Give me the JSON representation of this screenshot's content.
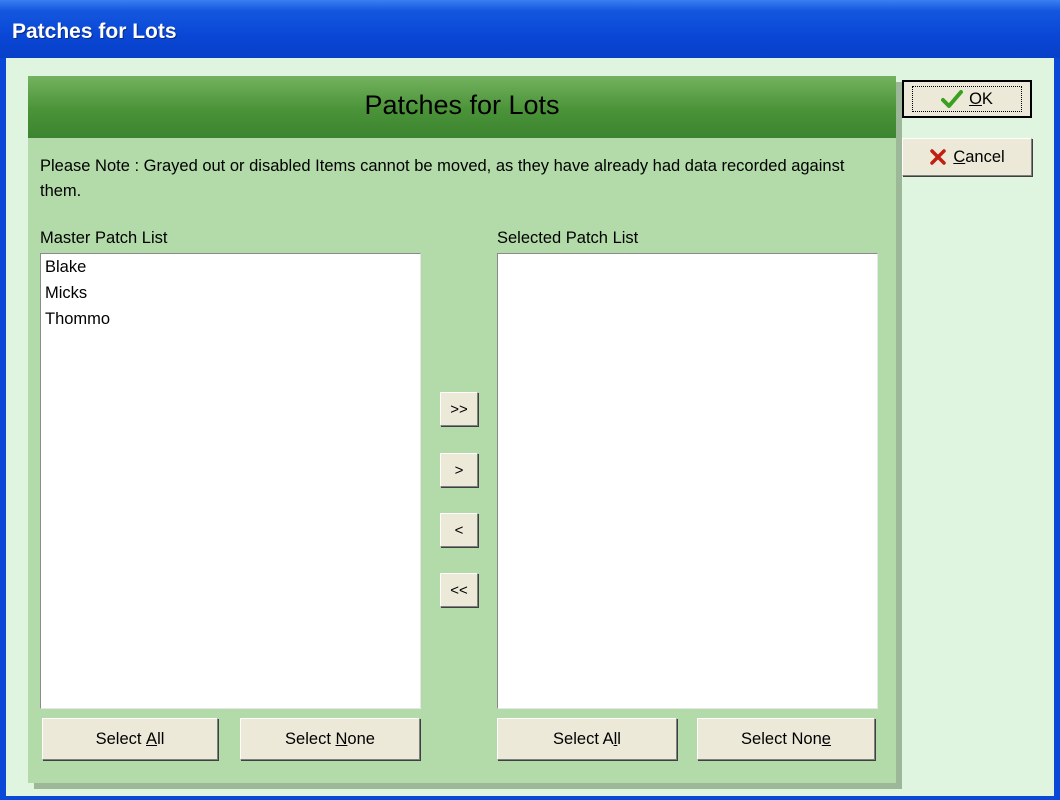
{
  "window": {
    "title": "Patches for Lots"
  },
  "panel": {
    "title": "Patches for Lots",
    "note": "Please Note : Grayed out or disabled Items cannot be moved, as they have already had data recorded against them."
  },
  "master": {
    "label": "Master Patch List",
    "items": [
      "Blake",
      "Micks",
      "Thommo"
    ],
    "select_all": {
      "pre": "Select ",
      "ul": "A",
      "post": "ll"
    },
    "select_none": {
      "pre": "Select ",
      "ul": "N",
      "post": "one"
    }
  },
  "selected": {
    "label": "Selected Patch List",
    "items": [],
    "select_all": {
      "pre": "Select A",
      "ul": "l",
      "post": "l"
    },
    "select_none": {
      "pre": "Select Non",
      "ul": "e",
      "post": ""
    }
  },
  "move_buttons": {
    "add_all": ">>",
    "add_one": ">",
    "remove_one": "<",
    "remove_all": "<<"
  },
  "actions": {
    "ok": {
      "ul": "O",
      "post": "K"
    },
    "cancel": {
      "ul": "C",
      "post": "ancel"
    }
  },
  "colors": {
    "title_bar": "#0a47d6",
    "client_bg": "#dff5df",
    "panel_bg": "#b3dba9",
    "header_green": "#4a9338",
    "ok_check": "#3aa020",
    "cancel_x": "#c02010"
  },
  "icons": {
    "ok": "check-icon",
    "cancel": "x-icon"
  }
}
